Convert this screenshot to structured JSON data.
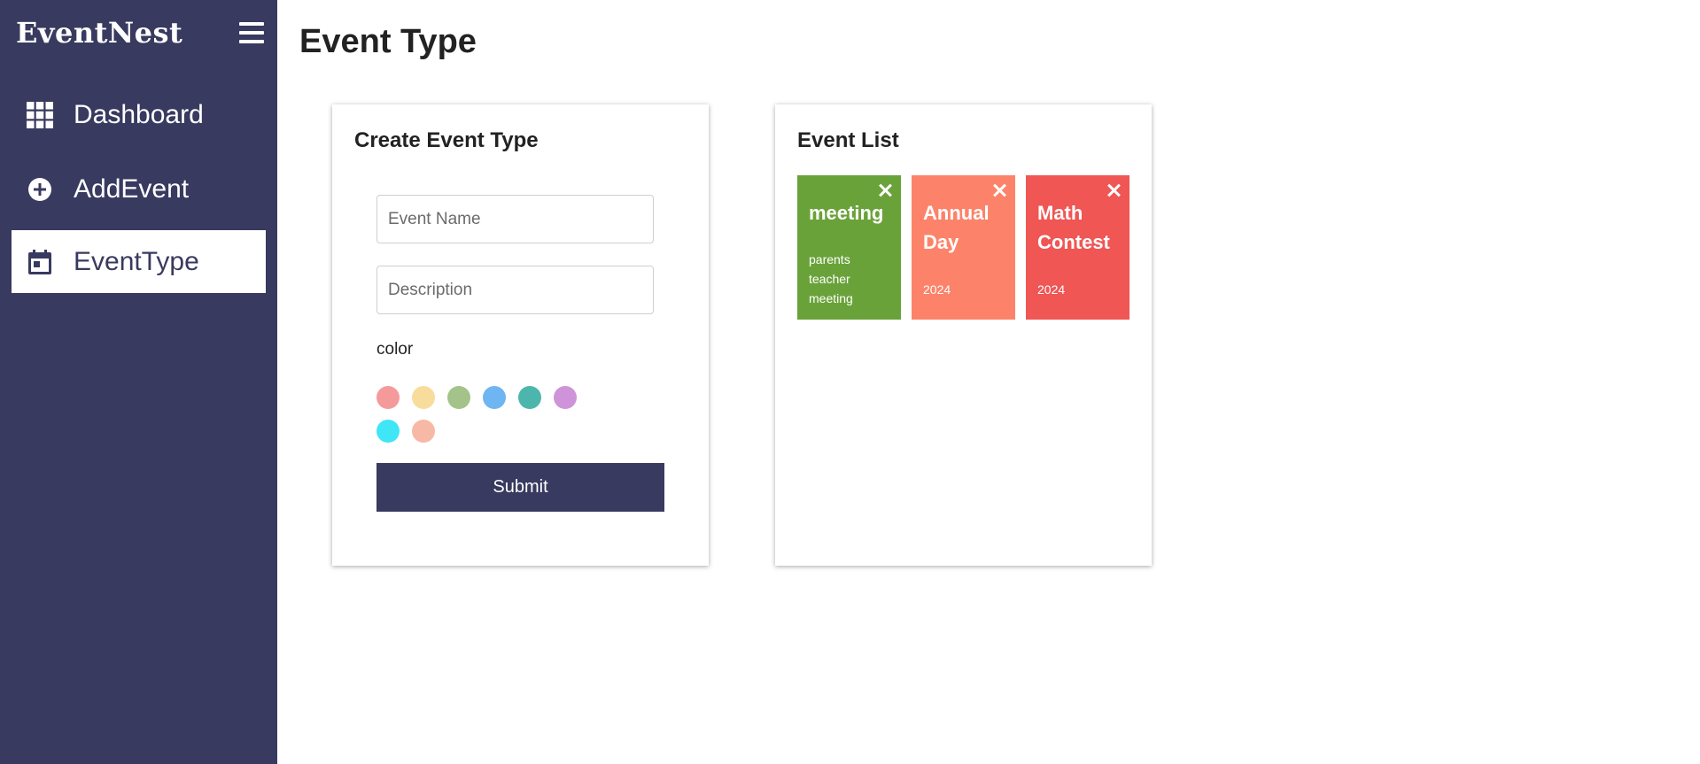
{
  "app": {
    "brand": "EventNest"
  },
  "sidebar": {
    "items": [
      {
        "label": "Dashboard",
        "icon": "grid-icon"
      },
      {
        "label": "AddEvent",
        "icon": "plus-circle-icon"
      },
      {
        "label": "EventType",
        "icon": "calendar-icon",
        "active": true
      }
    ]
  },
  "page": {
    "title": "Event Type"
  },
  "create": {
    "title": "Create Event Type",
    "name_placeholder": "Event Name",
    "desc_placeholder": "Description",
    "color_label": "color",
    "swatches": [
      "#f59a9a",
      "#f8dc9c",
      "#a4c38a",
      "#6fb5f2",
      "#4db6ac",
      "#ce93d8",
      "#3ee6f6",
      "#f8b8a6"
    ],
    "submit_label": "Submit"
  },
  "list": {
    "title": "Event List",
    "events": [
      {
        "name": "meeting",
        "description": "parents teacher meeting",
        "color": "#6aa23a"
      },
      {
        "name": "Annual Day",
        "description": "2024",
        "color": "#fc836a"
      },
      {
        "name": "Math Contest",
        "description": "2024",
        "color": "#ef5654"
      }
    ]
  }
}
